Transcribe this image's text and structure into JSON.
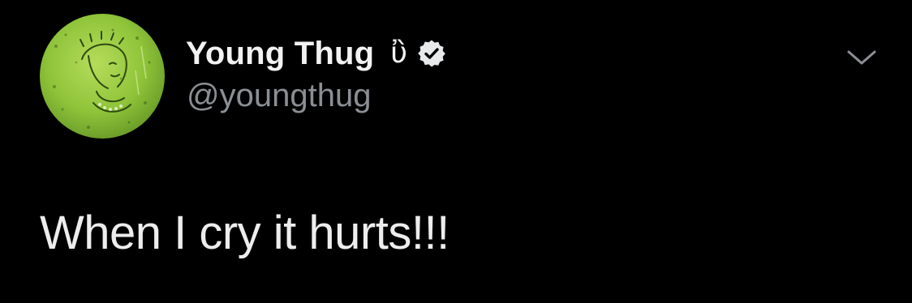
{
  "tweet": {
    "author": {
      "display_name": "Young Thug",
      "name_emoji": "ὒ",
      "handle": "@youngthug",
      "verified": true,
      "avatar_description_icon": "profile-avatar-green-artwork"
    },
    "text": "When I cry it hurts!!!",
    "menu_icon": "chevron-down-icon"
  },
  "colors": {
    "background": "#000000",
    "name_text": "#f2f2f2",
    "handle_text": "#8b8f94",
    "body_text": "#ededed",
    "avatar_green": "#8fc43a"
  }
}
